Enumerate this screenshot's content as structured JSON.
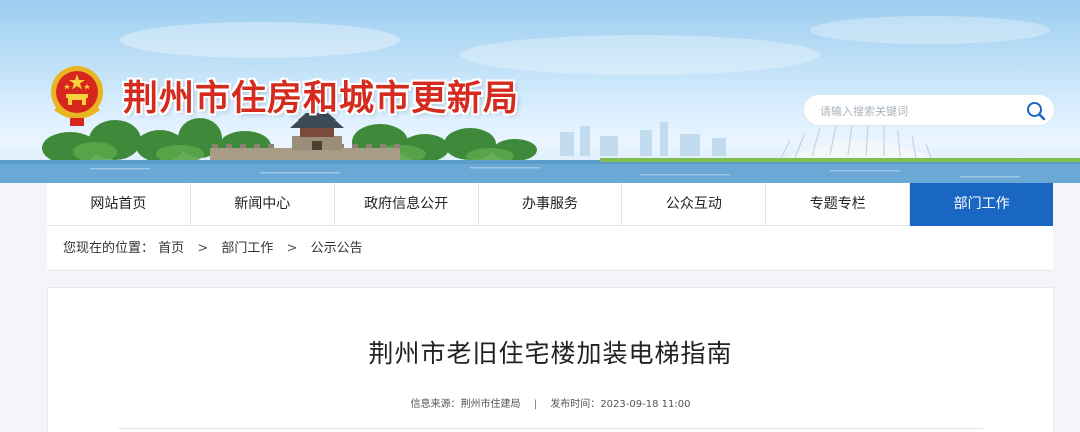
{
  "header": {
    "site_title": "荆州市住房和城市更新局",
    "search": {
      "placeholder": "请输入搜索关键词",
      "value": ""
    }
  },
  "icons": {
    "emblem": "national-emblem-icon",
    "search": "search-icon"
  },
  "colors": {
    "title_red": "#d52a1e",
    "nav_active": "#1967c2"
  },
  "nav": {
    "items": [
      {
        "label": "网站首页"
      },
      {
        "label": "新闻中心"
      },
      {
        "label": "政府信息公开"
      },
      {
        "label": "办事服务"
      },
      {
        "label": "公众互动"
      },
      {
        "label": "专题专栏"
      },
      {
        "label": "部门工作",
        "active": true
      }
    ]
  },
  "breadcrumb": {
    "prefix": "您现在的位置：",
    "items": [
      "首页",
      "部门工作",
      "公示公告"
    ],
    "separator": ">"
  },
  "article": {
    "title": "荆州市老旧住宅楼加装电梯指南",
    "meta": {
      "source_label": "信息来源：",
      "source": "荆州市住建局",
      "divider": "|",
      "date_label": "发布时间：",
      "date": "2023-09-18 11:00"
    }
  }
}
